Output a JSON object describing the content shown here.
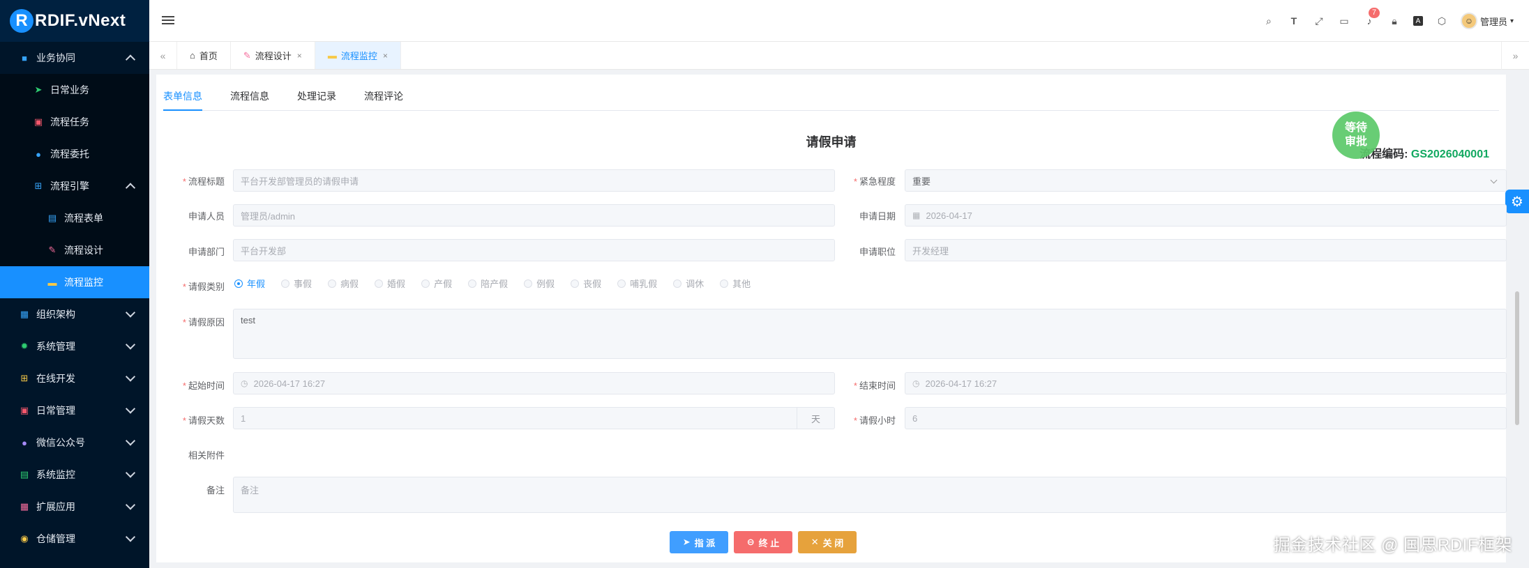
{
  "app": {
    "logo_mark": "R",
    "logo_text": "RDIF.vNext"
  },
  "sidebar": {
    "items": [
      {
        "label": "业务协同",
        "icon": "briefcase-icon",
        "color": "#36a3f7",
        "state": "up"
      },
      {
        "label": "日常业务",
        "icon": "send-icon",
        "color": "#2ecc71"
      },
      {
        "label": "流程任务",
        "icon": "clipboard-icon",
        "color": "#f5576c"
      },
      {
        "label": "流程委托",
        "icon": "people-icon",
        "color": "#36a3f7"
      },
      {
        "label": "流程引擎",
        "icon": "flow-icon",
        "color": "#36a3f7",
        "state": "up"
      },
      {
        "label": "流程表单",
        "icon": "form-icon",
        "color": "#36a3f7"
      },
      {
        "label": "流程设计",
        "icon": "design-icon",
        "color": "#f56c9c"
      },
      {
        "label": "流程监控",
        "icon": "monitor-icon",
        "color": "#f7c948"
      },
      {
        "label": "组织架构",
        "icon": "org-icon",
        "color": "#36a3f7",
        "state": "down"
      },
      {
        "label": "系统管理",
        "icon": "gear-icon",
        "color": "#2ecc71",
        "state": "down"
      },
      {
        "label": "在线开发",
        "icon": "grid-icon",
        "color": "#f7c948",
        "state": "down"
      },
      {
        "label": "日常管理",
        "icon": "calendar-icon",
        "color": "#f5576c",
        "state": "down"
      },
      {
        "label": "微信公众号",
        "icon": "wechat-icon",
        "color": "#a78bfa",
        "state": "down"
      },
      {
        "label": "系统监控",
        "icon": "server-icon",
        "color": "#2ecc71",
        "state": "down"
      },
      {
        "label": "扩展应用",
        "icon": "apps-icon",
        "color": "#f56c9c",
        "state": "down"
      },
      {
        "label": "仓储管理",
        "icon": "warehouse-icon",
        "color": "#f7c948",
        "state": "down"
      }
    ]
  },
  "header": {
    "user": "管理员",
    "notify_count": "7"
  },
  "tabs": [
    {
      "label": "首页",
      "icon": "home-icon"
    },
    {
      "label": "流程设计",
      "icon": "design-icon",
      "close": "×"
    },
    {
      "label": "流程监控",
      "icon": "monitor-icon",
      "close": "×"
    }
  ],
  "form_tabs": [
    "表单信息",
    "流程信息",
    "处理记录",
    "流程评论"
  ],
  "form": {
    "title": "请假申请",
    "code_label": "流程编码:",
    "code_value": "GS2026040001",
    "stamp": "等待审批",
    "fields": {
      "title_label": "流程标题",
      "title_value": "平台开发部管理员的请假申请",
      "urgency_label": "紧急程度",
      "urgency_value": "重要",
      "applicant_label": "申请人员",
      "applicant_value": "管理员/admin",
      "date_label": "申请日期",
      "date_value": "2026-04-17",
      "dept_label": "申请部门",
      "dept_value": "平台开发部",
      "position_label": "申请职位",
      "position_value": "开发经理",
      "type_label": "请假类别",
      "types": [
        "年假",
        "事假",
        "病假",
        "婚假",
        "产假",
        "陪产假",
        "例假",
        "丧假",
        "哺乳假",
        "调休",
        "其他"
      ],
      "reason_label": "请假原因",
      "reason_value": "test",
      "start_label": "起始时间",
      "start_value": "2026-04-17 16:27",
      "end_label": "结束时间",
      "end_value": "2026-04-17 16:27",
      "days_label": "请假天数",
      "days_value": "1",
      "days_unit": "天",
      "hours_label": "请假小时",
      "hours_value": "6",
      "attach_label": "相关附件",
      "remark_label": "备注",
      "remark_placeholder": "备注"
    }
  },
  "buttons": {
    "assign": "指 派",
    "terminate": "终 止",
    "close": "关 闭"
  },
  "watermark": "掘金技术社区 @ 国思RDIF框架"
}
